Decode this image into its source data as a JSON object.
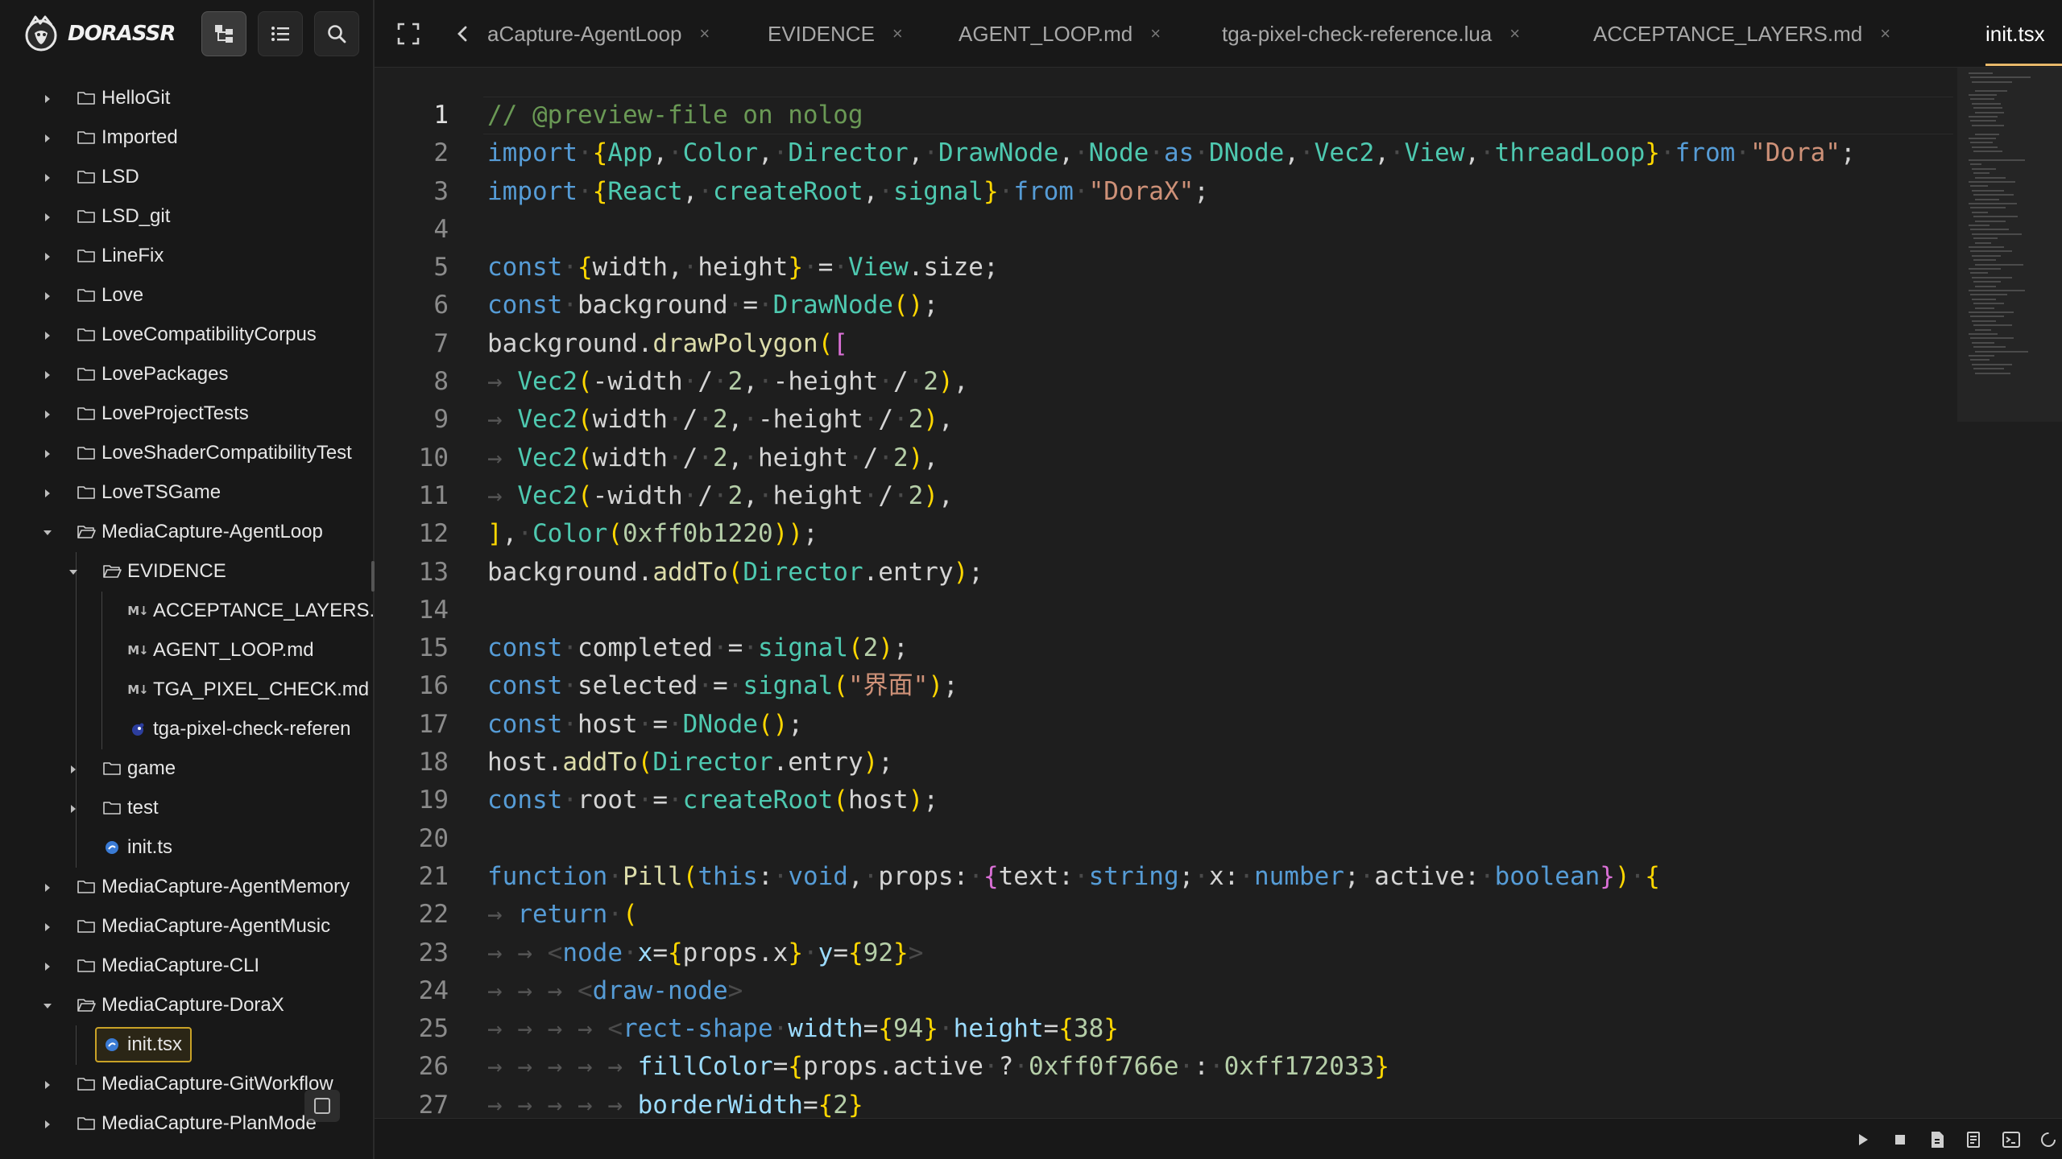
{
  "app": {
    "name": "DORASSR"
  },
  "sidebar_buttons": [
    {
      "name": "tree-view",
      "icon": "file-tree-icon",
      "active": true
    },
    {
      "name": "list-view",
      "icon": "list-icon",
      "active": false
    },
    {
      "name": "search",
      "icon": "search-icon",
      "active": false
    }
  ],
  "tree": [
    {
      "label": "HelloGit",
      "type": "folder",
      "depth": 0,
      "expanded": false
    },
    {
      "label": "Imported",
      "type": "folder",
      "depth": 0,
      "expanded": false
    },
    {
      "label": "LSD",
      "type": "folder",
      "depth": 0,
      "expanded": false
    },
    {
      "label": "LSD_git",
      "type": "folder",
      "depth": 0,
      "expanded": false
    },
    {
      "label": "LineFix",
      "type": "folder",
      "depth": 0,
      "expanded": false
    },
    {
      "label": "Love",
      "type": "folder",
      "depth": 0,
      "expanded": false
    },
    {
      "label": "LoveCompatibilityCorpus",
      "type": "folder",
      "depth": 0,
      "expanded": false
    },
    {
      "label": "LovePackages",
      "type": "folder",
      "depth": 0,
      "expanded": false
    },
    {
      "label": "LoveProjectTests",
      "type": "folder",
      "depth": 0,
      "expanded": false
    },
    {
      "label": "LoveShaderCompatibilityTest",
      "type": "folder",
      "depth": 0,
      "expanded": false
    },
    {
      "label": "LoveTSGame",
      "type": "folder",
      "depth": 0,
      "expanded": false
    },
    {
      "label": "MediaCapture-AgentLoop",
      "type": "folder",
      "depth": 0,
      "expanded": true
    },
    {
      "label": "EVIDENCE",
      "type": "folder",
      "depth": 1,
      "expanded": true
    },
    {
      "label": "ACCEPTANCE_LAYERS.",
      "type": "md",
      "depth": 2
    },
    {
      "label": "AGENT_LOOP.md",
      "type": "md",
      "depth": 2
    },
    {
      "label": "TGA_PIXEL_CHECK.md",
      "type": "md",
      "depth": 2
    },
    {
      "label": "tga-pixel-check-referen",
      "type": "lua",
      "depth": 2
    },
    {
      "label": "game",
      "type": "folder",
      "depth": 1,
      "expanded": false
    },
    {
      "label": "test",
      "type": "folder",
      "depth": 1,
      "expanded": false
    },
    {
      "label": "init.ts",
      "type": "ts",
      "depth": 1
    },
    {
      "label": "MediaCapture-AgentMemory",
      "type": "folder",
      "depth": 0,
      "expanded": false
    },
    {
      "label": "MediaCapture-AgentMusic",
      "type": "folder",
      "depth": 0,
      "expanded": false
    },
    {
      "label": "MediaCapture-CLI",
      "type": "folder",
      "depth": 0,
      "expanded": false
    },
    {
      "label": "MediaCapture-DoraX",
      "type": "folder",
      "depth": 0,
      "expanded": true
    },
    {
      "label": "init.tsx",
      "type": "ts",
      "depth": 1,
      "selected": true
    },
    {
      "label": "MediaCapture-GitWorkflow",
      "type": "folder",
      "depth": 0,
      "expanded": false
    },
    {
      "label": "MediaCapture-PlanMode",
      "type": "folder",
      "depth": 0,
      "expanded": false
    }
  ],
  "tabs": [
    {
      "label": "aCapture-AgentLoop",
      "active": false
    },
    {
      "label": "EVIDENCE",
      "active": false
    },
    {
      "label": "AGENT_LOOP.md",
      "active": false
    },
    {
      "label": "tga-pixel-check-reference.lua",
      "active": false
    },
    {
      "label": "ACCEPTANCE_LAYERS.md",
      "active": false
    },
    {
      "label": "init.tsx",
      "active": true
    }
  ],
  "tab_close_glyph": "×",
  "editor": {
    "current_line": 1,
    "lines": [
      "// @preview-file on nolog",
      "import {App, Color, Director, DrawNode, Node as DNode, Vec2, View, threadLoop} from \"Dora\";",
      "import {React, createRoot, signal} from \"DoraX\";",
      "",
      "const {width, height} = View.size;",
      "const background = DrawNode();",
      "background.drawPolygon([",
      "  Vec2(-width / 2, -height / 2),",
      "  Vec2(width / 2, -height / 2),",
      "  Vec2(width / 2, height / 2),",
      "  Vec2(-width / 2, height / 2),",
      "], Color(0xff0b1220));",
      "background.addTo(Director.entry);",
      "",
      "const completed = signal(2);",
      "const selected = signal(\"界面\");",
      "const host = DNode();",
      "host.addTo(Director.entry);",
      "const root = createRoot(host);",
      "",
      "function Pill(this: void, props: {text: string; x: number; active: boolean}) {",
      "  return (",
      "    <node x={props.x} y={92}>",
      "      <draw-node>",
      "        <rect-shape width={94} height={38}",
      "          fillColor={props.active ? 0xff0f766e : 0xff172033}",
      "          borderWidth={2}"
    ]
  },
  "status_icons": [
    "play-icon",
    "stop-icon",
    "file-icon",
    "notes-icon",
    "terminal-icon",
    "spinner-icon"
  ],
  "colors": {
    "background": "#1e1e1e",
    "sidebar": "#181818",
    "keyword": "#569cd6",
    "function": "#dcdcaa",
    "type": "#4ec9b0",
    "string": "#ce9178",
    "number": "#b5cea8",
    "comment": "#6a9955",
    "selection_border": "#c9a227",
    "tab_underline": "#e8b86a"
  }
}
